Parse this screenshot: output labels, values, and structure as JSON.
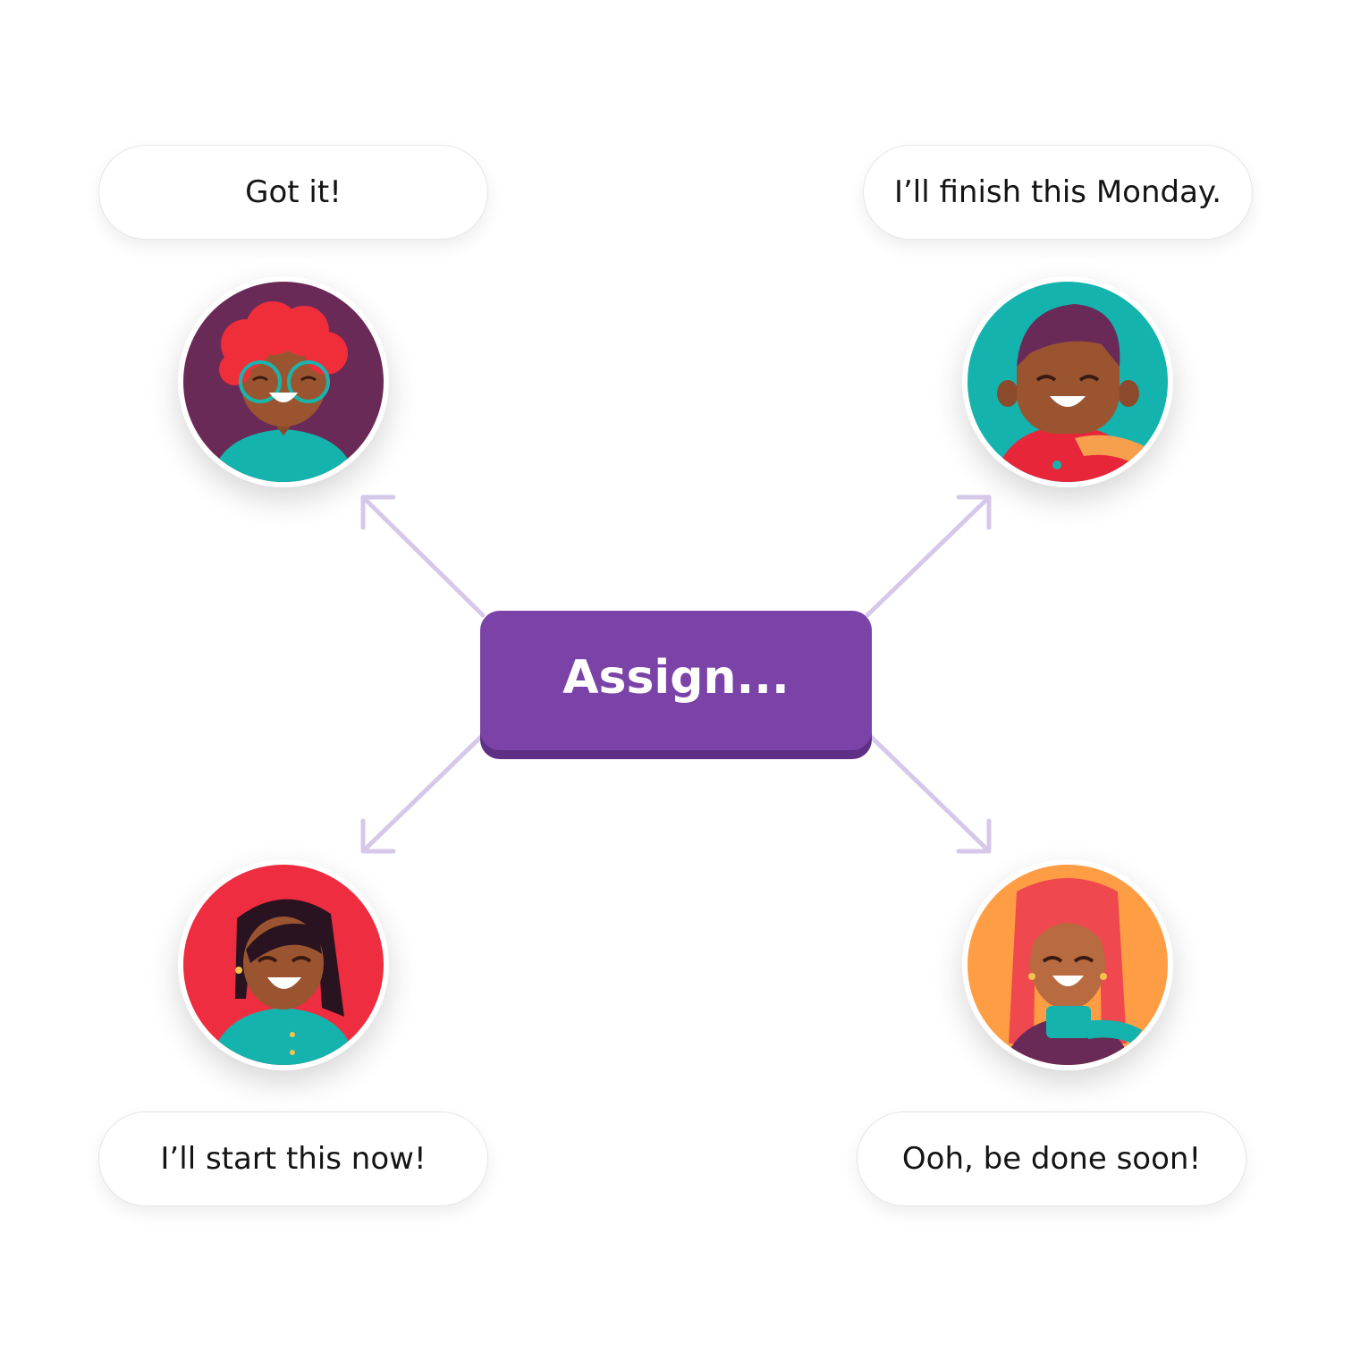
{
  "center": {
    "label": "Assign..."
  },
  "responses": [
    {
      "text": "Got it!",
      "avatar_icon": "woman-curly-red-hair-glasses-avatar",
      "bg": "#6a2a57"
    },
    {
      "text": "I’ll finish this Monday.",
      "avatar_icon": "man-purple-hair-scarf-avatar",
      "bg": "#14b3ae"
    },
    {
      "text": "I’ll start this now!",
      "avatar_icon": "woman-black-hair-teal-shirt-avatar",
      "bg": "#ee2d40"
    },
    {
      "text": "Ooh, be done soon!",
      "avatar_icon": "woman-pink-hair-teal-scarf-avatar",
      "bg": "#ff9d45"
    }
  ],
  "colors": {
    "button": "#7b43a8",
    "arrow": "#d6c8ea"
  }
}
